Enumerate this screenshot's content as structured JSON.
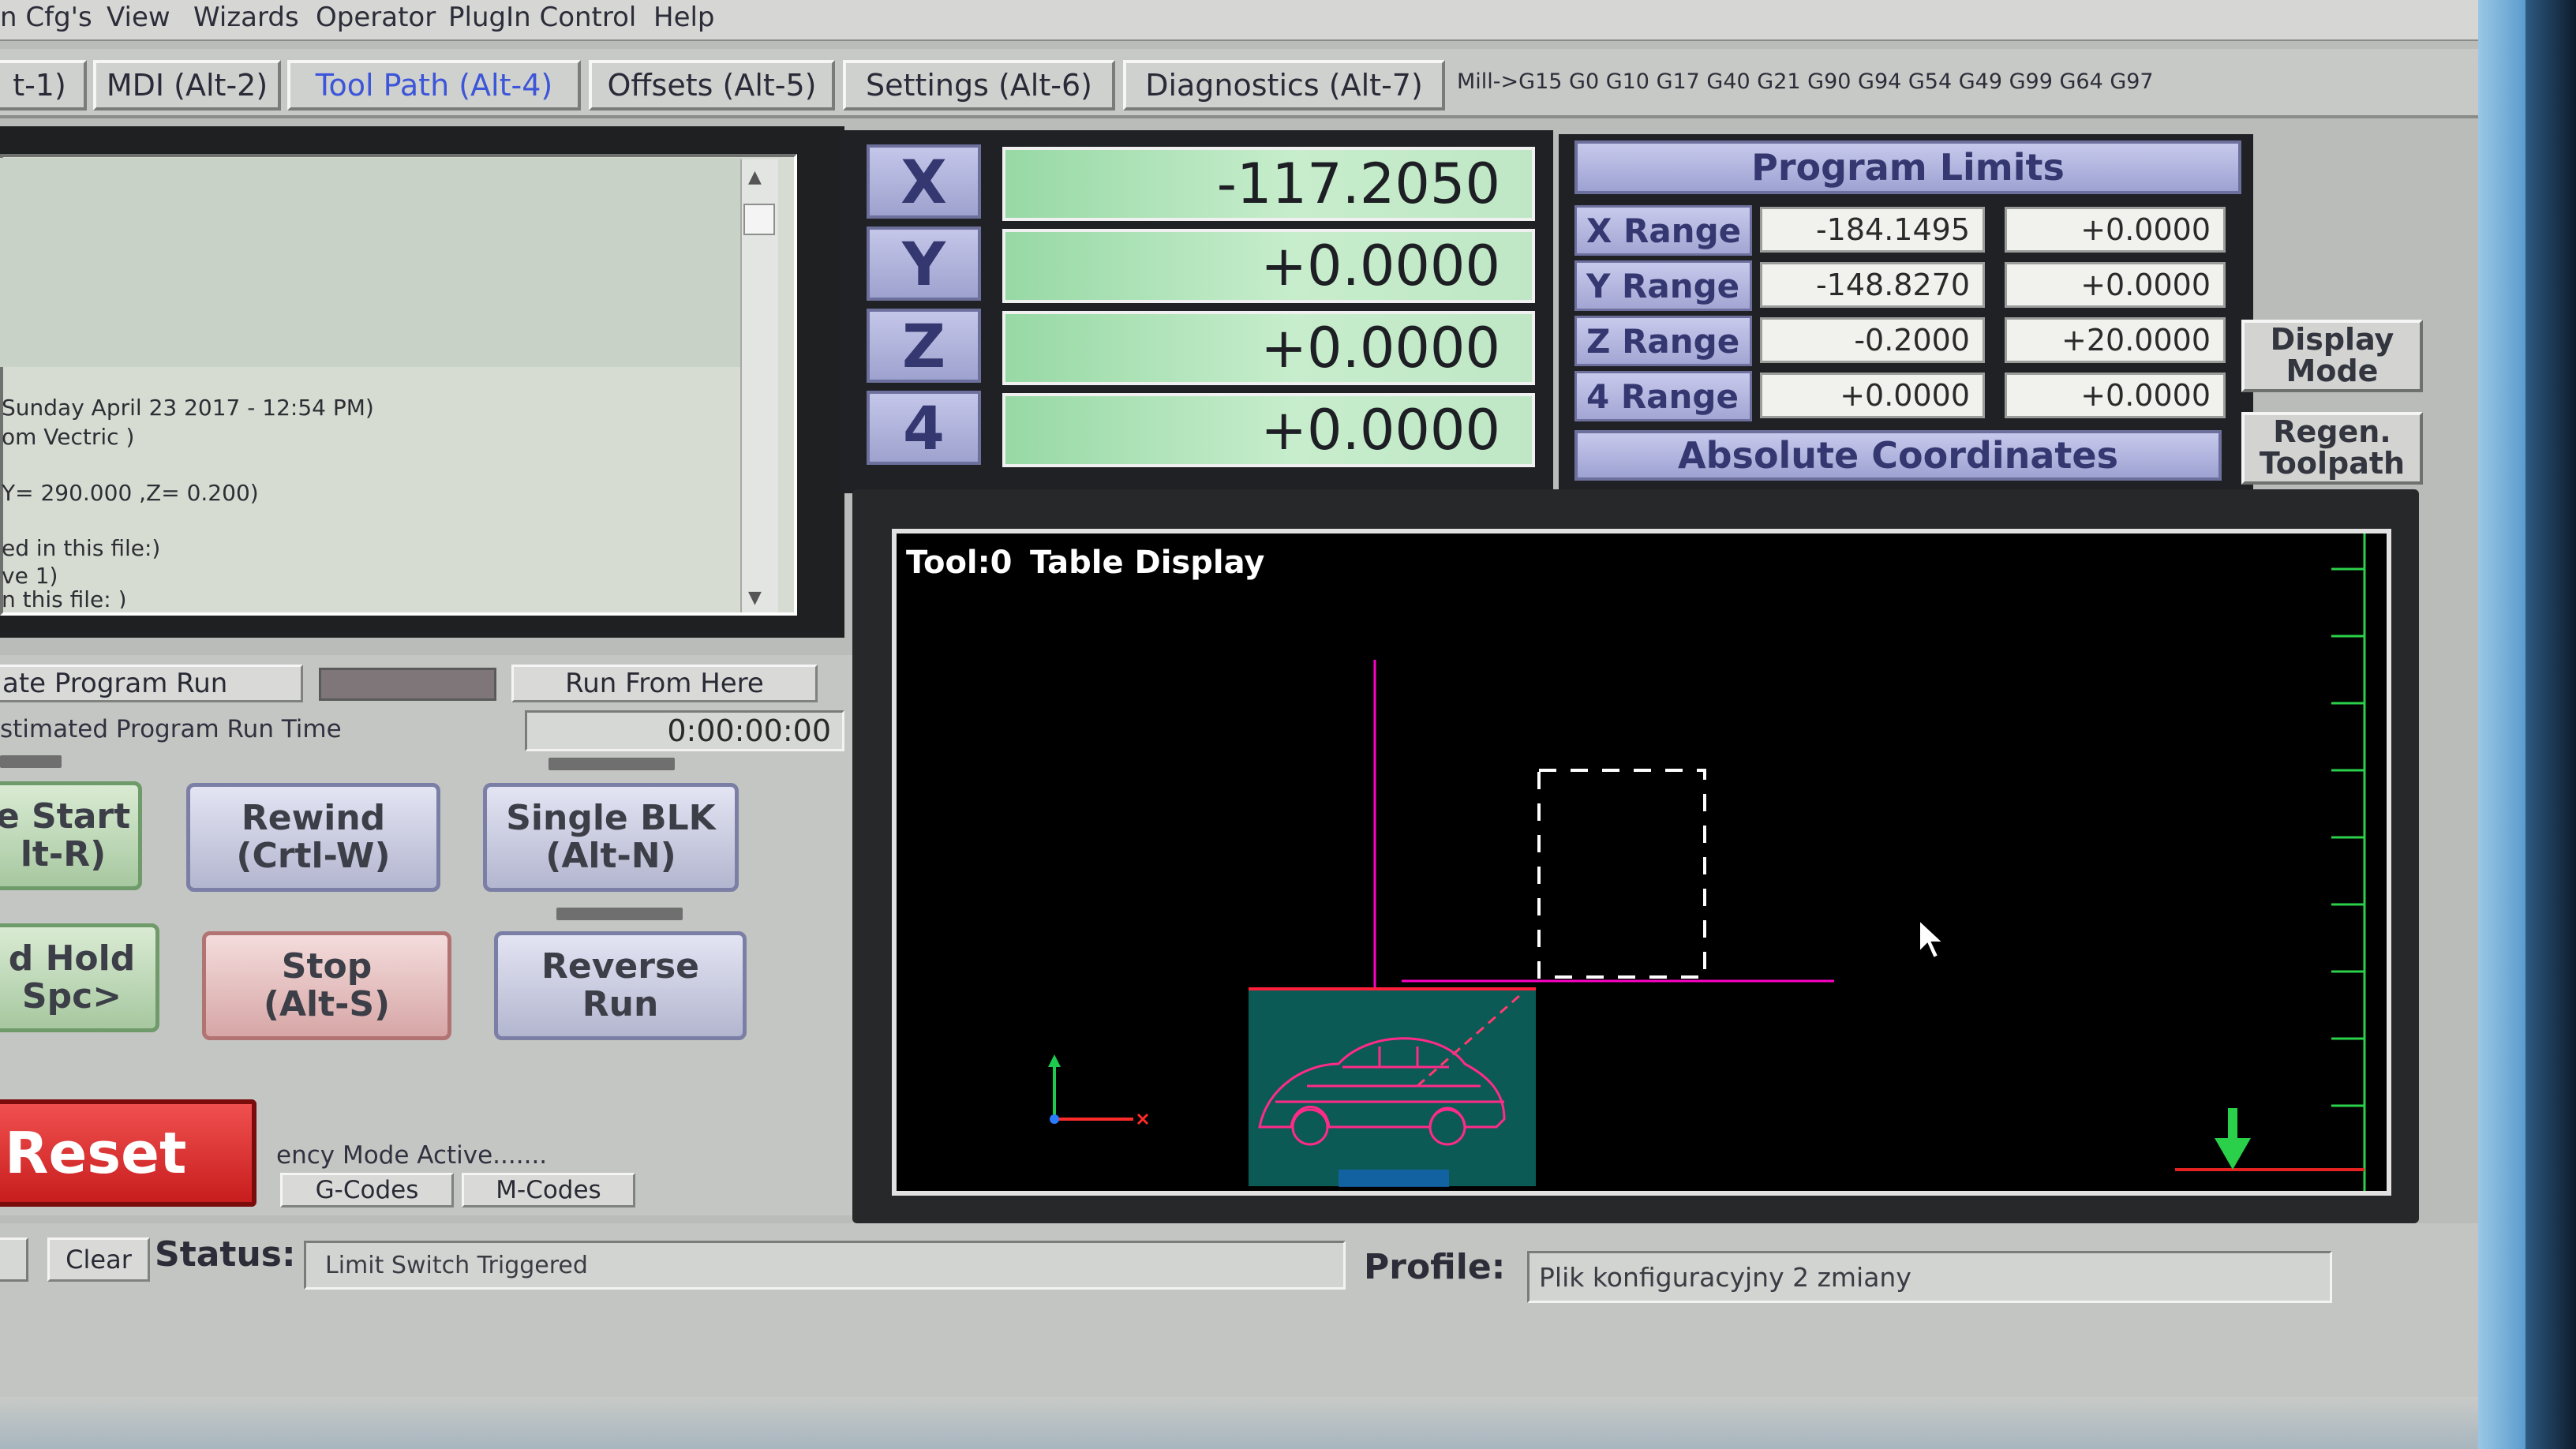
{
  "menu": [
    "n Cfg's",
    "View",
    "Wizards",
    "Operator",
    "PlugIn Control",
    "Help"
  ],
  "tabs": [
    {
      "label": "t-1)"
    },
    {
      "label": "MDI (Alt-2)"
    },
    {
      "label": "Tool Path (Alt-4)",
      "active": true
    },
    {
      "label": "Offsets (Alt-5)"
    },
    {
      "label": "Settings (Alt-6)"
    },
    {
      "label": "Diagnostics (Alt-7)"
    }
  ],
  "modal_codes": "Mill->G15  G0 G10 G17 G40 G21 G90 G94 G54 G49 G99 G64 G97",
  "gcode_lines": [
    "Sunday April 23 2017 - 12:54 PM)",
    "om Vectric )",
    "",
    "Y= 290.000 ,Z= 0.200)",
    "",
    "ed in this file:)",
    "ve 1)",
    "n this file: )"
  ],
  "program_run": {
    "simulate_label": "ate Program Run",
    "run_from_here_label": "Run From Here",
    "estimated_label": "stimated Program Run Time",
    "estimated_time": "0:00:00:00"
  },
  "buttons": {
    "cycle_start": [
      "e Start",
      "lt-R)"
    ],
    "rewind": [
      "Rewind",
      "(Crtl-W)"
    ],
    "single_blk": [
      "Single BLK",
      "(Alt-N)"
    ],
    "feed_hold": [
      "d Hold",
      "Spc>"
    ],
    "stop": [
      "Stop",
      "(Alt-S)"
    ],
    "reverse_run": [
      "Reverse",
      "Run"
    ],
    "reset": "Reset"
  },
  "mode_active": "ency Mode Active.......",
  "gcodes_label": "G-Codes",
  "mcodes_label": "M-Codes",
  "dro": [
    {
      "axis": "X",
      "value": "-117.2050"
    },
    {
      "axis": "Y",
      "value": "+0.0000"
    },
    {
      "axis": "Z",
      "value": "+0.0000"
    },
    {
      "axis": "4",
      "value": "+0.0000"
    }
  ],
  "program_limits": {
    "title": "Program Limits",
    "rows": [
      {
        "label": "X Range",
        "min": "-184.1495",
        "max": "+0.0000"
      },
      {
        "label": "Y Range",
        "min": "-148.8270",
        "max": "+0.0000"
      },
      {
        "label": "Z Range",
        "min": "-0.2000",
        "max": "+20.0000"
      },
      {
        "label": "4 Range",
        "min": "+0.0000",
        "max": "+0.0000"
      }
    ],
    "mode": "Absolute Coordinates"
  },
  "side_buttons": {
    "display_mode": [
      "Display",
      "Mode"
    ],
    "regen": [
      "Regen.",
      "Toolpath"
    ]
  },
  "toolpath": {
    "tool": "Tool:0",
    "title": "Table Display"
  },
  "status": {
    "clear_label": "Clear",
    "status_label": "Status:",
    "status_text": "Limit Switch Triggered",
    "profile_label": "Profile:",
    "profile_text": "Plik konfiguracyjny 2 zmiany"
  },
  "colors": {
    "accent_blue": "#3d55d8",
    "dro_green": "#97d9a5",
    "reset_red": "#d32a2a",
    "path_magenta": "#ff00c8"
  }
}
